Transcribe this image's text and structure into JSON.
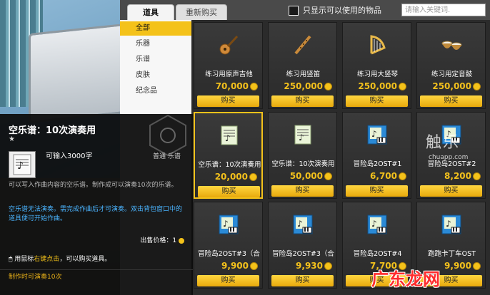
{
  "tabs": {
    "items": "道具",
    "repurchase": "重新购买"
  },
  "filter": {
    "label": "只显示可以使用的物品"
  },
  "search": {
    "placeholder": "请输入关键词."
  },
  "categories": [
    "全部",
    "乐器",
    "乐谱",
    "皮肤",
    "纪念品"
  ],
  "active_category": "全部",
  "buy_label": "购买",
  "items": [
    {
      "name": "练习用原声吉他",
      "price": "70,000",
      "icon": "guitar-icon"
    },
    {
      "name": "练习用竖笛",
      "price": "250,000",
      "icon": "flute-icon"
    },
    {
      "name": "练习用大竖琴",
      "price": "250,000",
      "icon": "harp-icon"
    },
    {
      "name": "练习用定音鼓",
      "price": "250,000",
      "icon": "timpani-icon"
    },
    {
      "name": "空乐谱：10次演奏用",
      "price": "20,000",
      "icon": "music-sheet-icon",
      "selected": true
    },
    {
      "name": "空乐谱：10次演奏用",
      "price": "50,000",
      "icon": "music-sheet-icon"
    },
    {
      "name": "冒险岛2OST#1",
      "price": "6,700",
      "icon": "music-score-icon"
    },
    {
      "name": "冒险岛2OST#2",
      "price": "8,200",
      "icon": "music-score-icon"
    },
    {
      "name": "冒险岛2OST#3（合",
      "price": "9,900",
      "icon": "music-score-icon"
    },
    {
      "name": "冒险岛2OST#3（合",
      "price": "9,930",
      "icon": "music-score-icon"
    },
    {
      "name": "冒险岛2OST#4",
      "price": "7,700",
      "icon": "music-score-icon"
    },
    {
      "name": "跑跑卡丁车OST",
      "price": "9,900",
      "icon": "music-score-icon"
    }
  ],
  "tooltip": {
    "title": "空乐谱：10次演奏用",
    "star": "★",
    "capacity": "可输入3000字",
    "type": "普通 乐谱",
    "desc": "可以写入作曲内容的空乐谱。制作成可以演奏10次的乐谱。",
    "warn": "空乐谱无法演奏。需完成作曲后才可演奏。双击背包窗口中的道具便可开始作曲。",
    "sell_price": "出售价格：1",
    "hint_pre": "用鼠标",
    "hint_highlight": "右键点击",
    "hint_post": "，可以购买道具。",
    "footer": "制作时可演奏10次"
  },
  "watermarks": {
    "brand": "触乐",
    "url": "chuapp.com",
    "site": "广东龙网"
  },
  "colors": {
    "accent": "#f4c21a",
    "price": "#f2c01c",
    "grid_bg": "#2b2b2b",
    "tooltip_blue": "#4ab4ff"
  }
}
